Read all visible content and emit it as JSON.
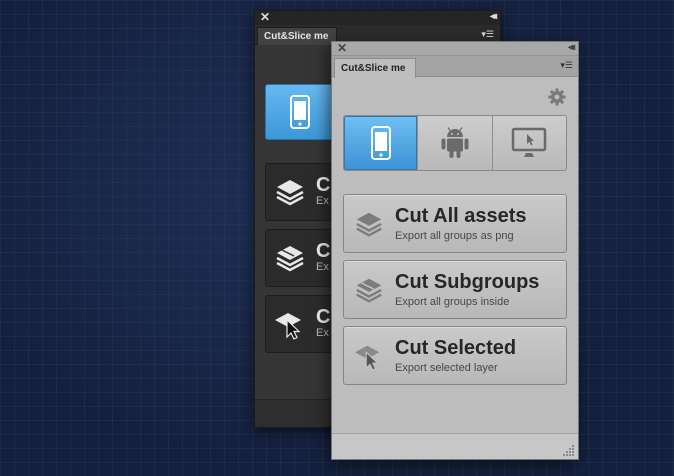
{
  "back_panel": {
    "tab_title": "Cut&Slice me",
    "buttons": [
      {
        "title": "C",
        "subtitle": "Ex"
      },
      {
        "title": "C",
        "subtitle": "Ex"
      },
      {
        "title": "C",
        "subtitle": "Ex"
      }
    ]
  },
  "front_panel": {
    "tab_title": "Cut&Slice me",
    "devices": [
      {
        "name": "ios",
        "icon": "iphone-icon",
        "active": true
      },
      {
        "name": "android",
        "icon": "android-icon",
        "active": false
      },
      {
        "name": "desktop",
        "icon": "monitor-icon",
        "active": false
      }
    ],
    "actions": [
      {
        "title": "Cut All assets",
        "subtitle": "Export all groups as png",
        "icon": "layers-icon"
      },
      {
        "title": "Cut Subgroups",
        "subtitle": "Export all groups inside",
        "icon": "sublayers-icon"
      },
      {
        "title": "Cut Selected",
        "subtitle": "Export selected layer",
        "icon": "cursor-layer-icon"
      }
    ]
  },
  "colors": {
    "accent": "#4aa6e4",
    "background": "#14203d",
    "dark_panel": "#353535",
    "light_panel": "#bdbdbd"
  }
}
